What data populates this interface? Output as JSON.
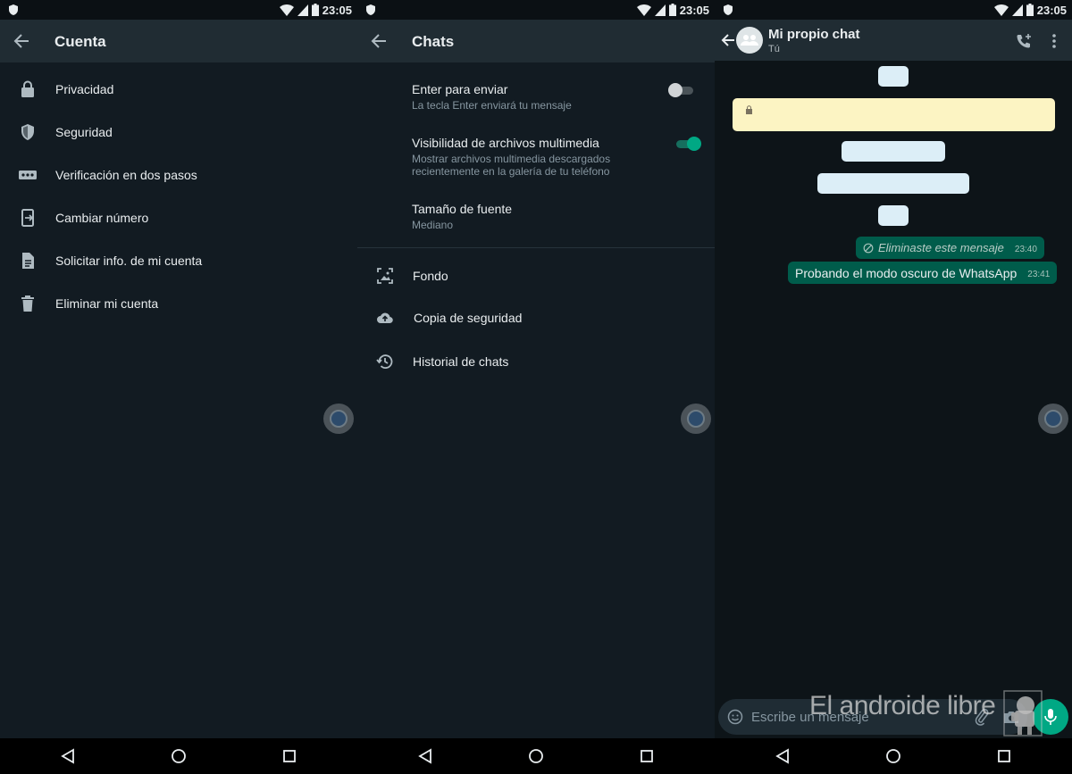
{
  "status_bar": {
    "time": "23:05"
  },
  "panel_account": {
    "title": "Cuenta",
    "items": [
      {
        "label": "Privacidad",
        "icon": "lock-icon"
      },
      {
        "label": "Seguridad",
        "icon": "shield-icon"
      },
      {
        "label": "Verificación en dos pasos",
        "icon": "dots-icon"
      },
      {
        "label": "Cambiar número",
        "icon": "phone-transfer-icon"
      },
      {
        "label": "Solicitar info. de mi cuenta",
        "icon": "document-icon"
      },
      {
        "label": "Eliminar mi cuenta",
        "icon": "trash-icon"
      }
    ]
  },
  "panel_chats": {
    "title": "Chats",
    "settings": [
      {
        "title": "Enter para enviar",
        "subtitle": "La tecla Enter enviará tu mensaje",
        "toggle": false
      },
      {
        "title": "Visibilidad de archivos multimedia",
        "subtitle": "Mostrar archivos multimedia descargados recientemente en la galería de tu teléfono",
        "toggle": true
      },
      {
        "title": "Tamaño de fuente",
        "subtitle": "Mediano"
      }
    ],
    "items": [
      {
        "label": "Fondo",
        "icon": "wallpaper-icon"
      },
      {
        "label": "Copia de seguridad",
        "icon": "cloud-upload-icon"
      },
      {
        "label": "Historial de chats",
        "icon": "history-icon"
      }
    ]
  },
  "panel_chat": {
    "title": "Mi propio chat",
    "subtitle": "Tú",
    "messages": [
      {
        "text": "Eliminaste este mensaje",
        "time": "23:40",
        "deleted": true
      },
      {
        "text": "Probando el modo oscuro de WhatsApp",
        "time": "23:41",
        "deleted": false
      }
    ],
    "compose_placeholder": "Escribe un mensaje"
  },
  "watermark": "El androide libre",
  "colors": {
    "background": "#121b22",
    "appbar": "#202c33",
    "accent": "#00a884",
    "outgoing_bubble": "#005c4b",
    "text_primary": "#e9edef",
    "text_secondary": "#8696a0"
  }
}
